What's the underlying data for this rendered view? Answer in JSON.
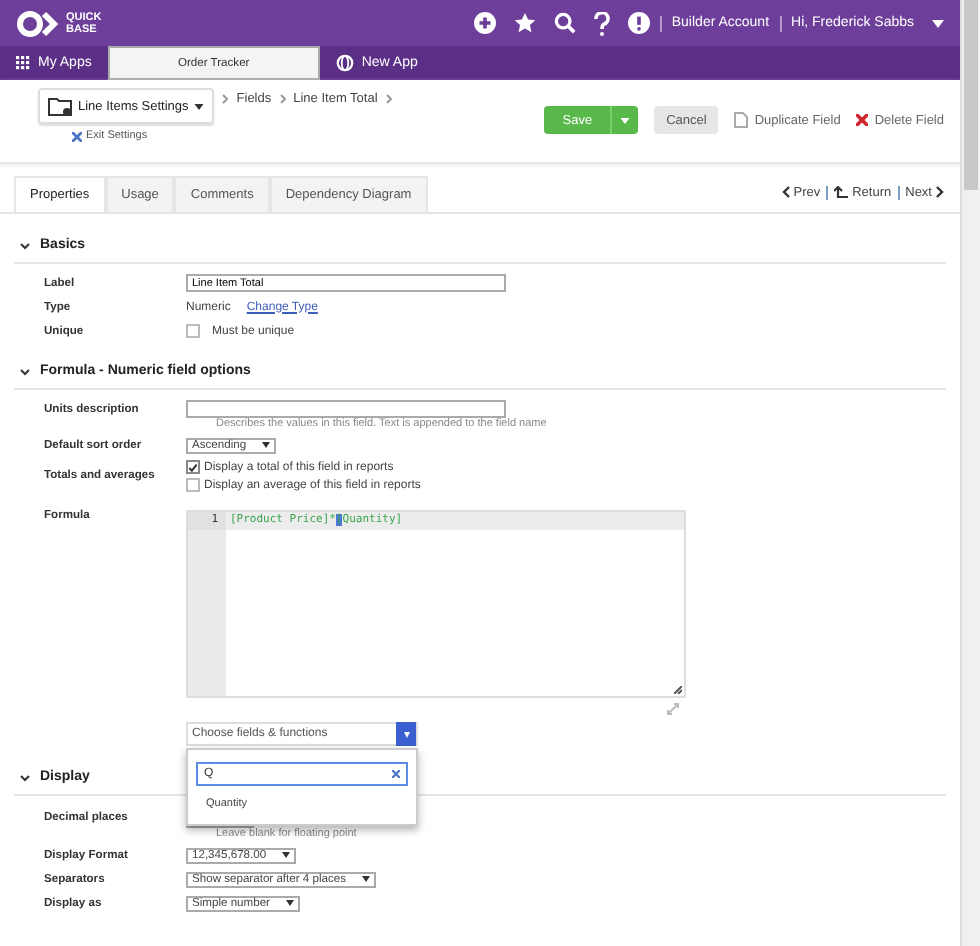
{
  "topbar": {
    "logo_line1": "QUICK",
    "logo_line2": "BASE",
    "account": "Builder Account",
    "user": "Hi, Frederick Sabbs"
  },
  "app_tabs": [
    {
      "label": "My Apps",
      "kind": "apps",
      "selected": false
    },
    {
      "label": "Order Tracker",
      "kind": "plain",
      "selected": true
    },
    {
      "label": "New App",
      "kind": "new",
      "selected": false
    }
  ],
  "settings": {
    "table_menu": "Line Items Settings",
    "breadcrumbs": [
      "Fields",
      "Line Item Total"
    ],
    "exit": "Exit Settings",
    "save": "Save",
    "cancel": "Cancel",
    "duplicate": "Duplicate Field",
    "delete": "Delete Field"
  },
  "tabs": [
    {
      "label": "Properties",
      "selected": true
    },
    {
      "label": "Usage",
      "selected": false
    },
    {
      "label": "Comments",
      "selected": false
    },
    {
      "label": "Dependency Diagram",
      "selected": false
    }
  ],
  "nav": {
    "prev": "Prev",
    "return": "Return",
    "next": "Next"
  },
  "basics": {
    "title": "Basics",
    "expanded": true,
    "label_label": "Label",
    "label_value": "Line Item Total",
    "type_label": "Type",
    "type_value": "Numeric",
    "change_type": "Change Type",
    "unique_label": "Unique",
    "unique_text": "Must be unique",
    "unique_checked": false
  },
  "formula_section": {
    "title": "Formula - Numeric field options",
    "expanded": true,
    "units_label": "Units description",
    "units_hint": "Describes the values in this field. Text is appended to the field name",
    "sort_label": "Default sort order",
    "sort_value": "Ascending",
    "totals_label": "Totals and averages",
    "totals_options": [
      {
        "label": "Display a total of this field in reports",
        "checked": true
      },
      {
        "label": "Display an average of this field in reports",
        "checked": false
      }
    ],
    "formula_label": "Formula",
    "line_number": "1",
    "code_before": "[Product Price]*",
    "code_cursor": "[",
    "code_after": "Quantity]",
    "chooser": "Choose fields & functions",
    "search_value": "Q",
    "results": [
      "Quantity"
    ]
  },
  "display": {
    "title": "Display",
    "expanded": true,
    "decimal_label": "Decimal places",
    "decimal_hint": "Leave blank for floating point",
    "format_label": "Display Format",
    "format_value": "12,345,678.00",
    "sep_label": "Separators",
    "sep_value": "Show separator after 4 places",
    "as_label": "Display as",
    "as_value": "Simple number"
  }
}
